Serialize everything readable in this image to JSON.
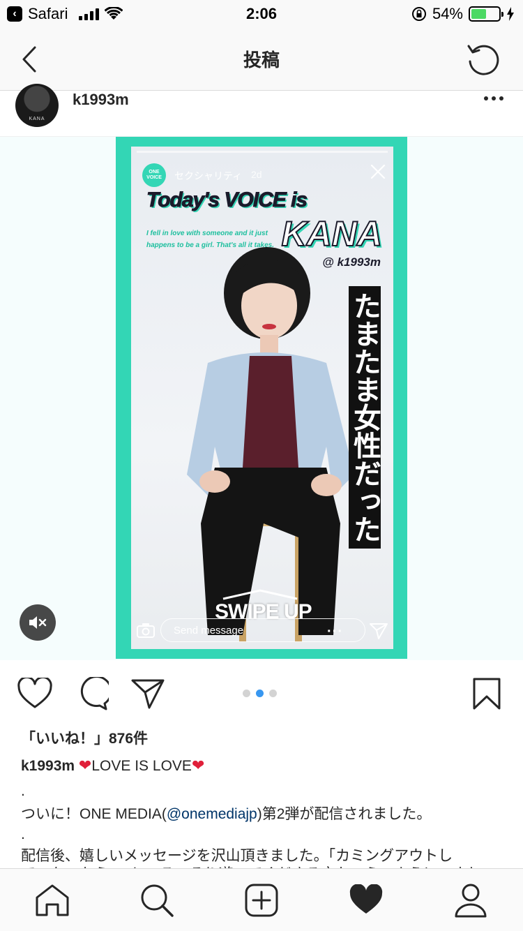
{
  "status_bar": {
    "back_app": "Safari",
    "time": "2:06",
    "battery_percent": "54%",
    "battery_level": 0.54
  },
  "nav": {
    "title": "投稿"
  },
  "post": {
    "username": "k1993m",
    "avatar_text": "KANA"
  },
  "story": {
    "channel_logo": "ONE VOICE",
    "channel_name": "セクシャリティ",
    "age": "2d",
    "headline": "Today's VOICE is",
    "name": "KANA",
    "quote": "I fell in love with someone and it just happens to be a girl. That's all it takes.",
    "handle": "@ k1993m",
    "vertical_caption": "たまたま女性だった",
    "swipe_up": "SWIPE UP",
    "send_message_placeholder": "Send message",
    "accent_color": "#33d6b5"
  },
  "actions": {
    "carousel_total": 3,
    "carousel_active": 2
  },
  "likes_text": "「いいね！」876件",
  "caption": {
    "username": "k1993m",
    "heading": "LOVE IS LOVE",
    "dot1": ".",
    "line2_prefix": "ついに！ONE MEDIA(",
    "line2_mention": "@onemediajp",
    "line2_suffix": ")第2弾が配信されました。",
    "dot2": ".",
    "line3": "配信後、嬉しいメッセージを沢山頂きました。「カミングアウトし",
    "line4": "ていないから、、ところ、そり遊、てくださる方たいら、ようにいまし"
  }
}
